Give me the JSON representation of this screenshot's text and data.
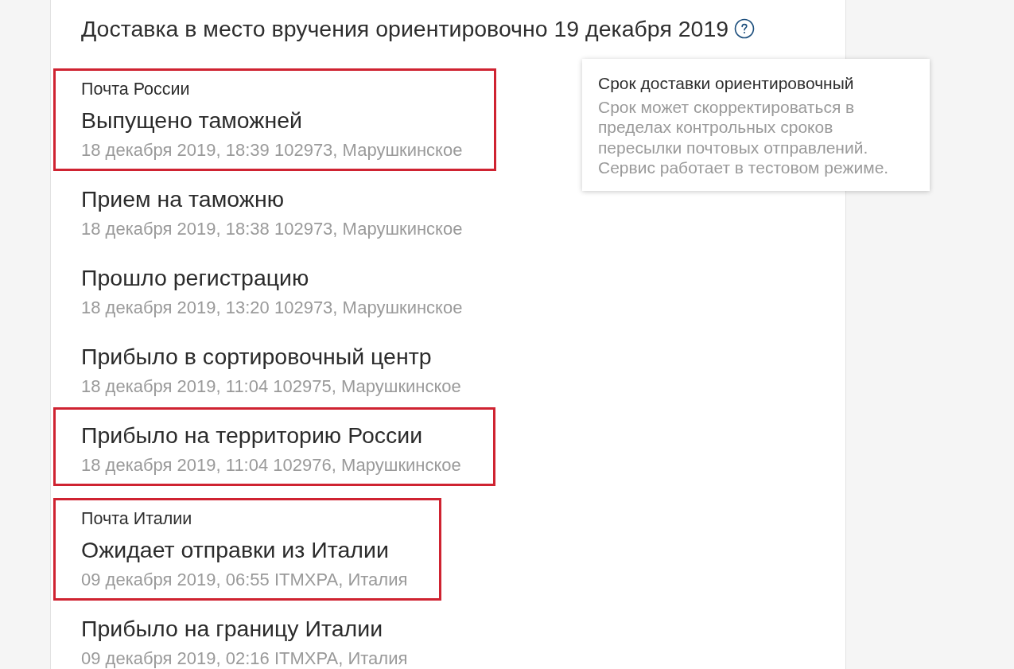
{
  "delivery_estimate": {
    "text": "Доставка в место вручения ориентировочно 19 декабря 2019"
  },
  "tooltip": {
    "title": "Срок доставки ориентировочный",
    "text": "Срок может скорректироваться в пределах контрольных сроков пересылки почтовых отправлений. Сервис работает в тестовом режиме."
  },
  "carriers": [
    {
      "name": "Почта России",
      "events": [
        {
          "status": "Выпущено таможней",
          "details": "18 декабря 2019, 18:39 102973, Марушкинское",
          "highlighted": true
        },
        {
          "status": "Прием на таможню",
          "details": "18 декабря 2019, 18:38 102973, Марушкинское",
          "highlighted": false
        },
        {
          "status": "Прошло регистрацию",
          "details": "18 декабря 2019, 13:20 102973, Марушкинское",
          "highlighted": false
        },
        {
          "status": "Прибыло в сортировочный центр",
          "details": "18 декабря 2019, 11:04 102975, Марушкинское",
          "highlighted": false
        },
        {
          "status": "Прибыло на территорию России",
          "details": "18 декабря 2019, 11:04 102976, Марушкинское",
          "highlighted": true
        }
      ]
    },
    {
      "name": "Почта Италии",
      "events": [
        {
          "status": "Ожидает отправки из Италии",
          "details": "09 декабря 2019, 06:55 ITMXPA, Италия",
          "highlighted": true
        },
        {
          "status": "Прибыло на границу Италии",
          "details": "09 декабря 2019, 02:16 ITMXPA, Италия",
          "highlighted": false
        }
      ]
    }
  ]
}
